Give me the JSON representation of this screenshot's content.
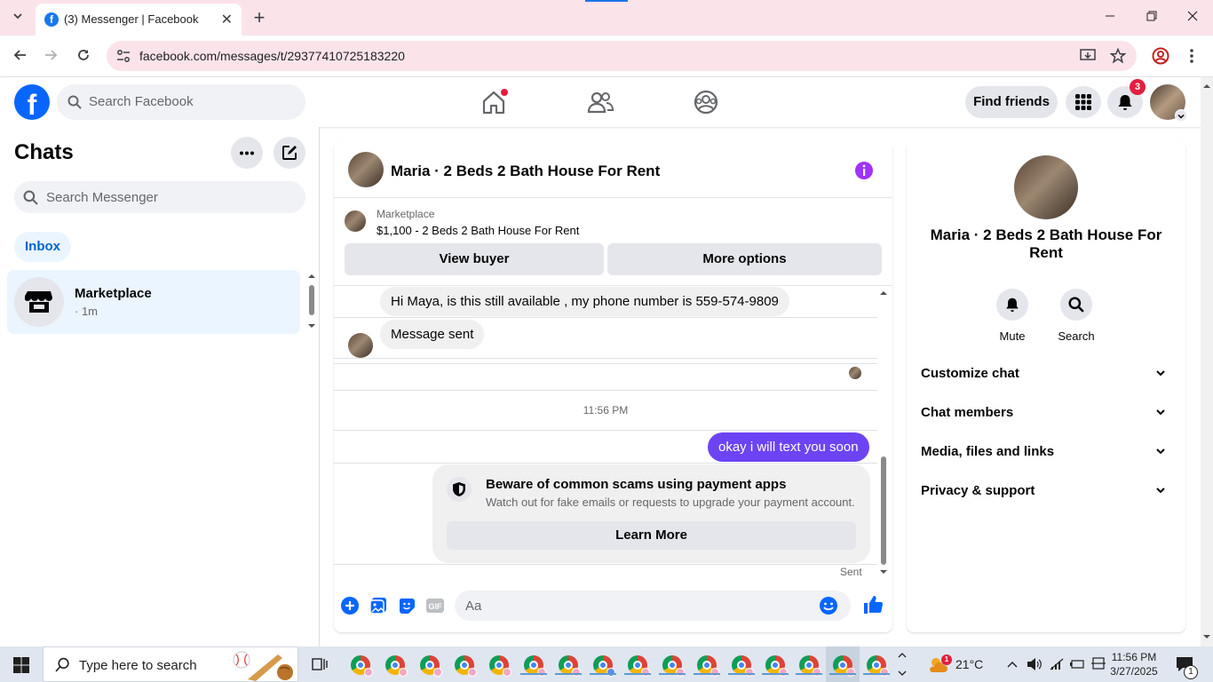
{
  "browser": {
    "tab_title": "(3) Messenger | Facebook",
    "url": "facebook.com/messages/t/29377410725183220"
  },
  "fb": {
    "search_placeholder": "Search Facebook",
    "find_friends": "Find friends",
    "notif_count": "3"
  },
  "chats": {
    "title": "Chats",
    "search_placeholder": "Search Messenger",
    "inbox_label": "Inbox",
    "items": [
      {
        "name": "Marketplace",
        "time": "· 1m"
      }
    ]
  },
  "conversation": {
    "title": "Maria · 2 Beds 2 Bath House For Rent",
    "marketplace_label": "Marketplace",
    "listing": "$1,100 - 2 Beds 2 Bath House For Rent",
    "view_buyer": "View buyer",
    "more_options": "More options",
    "messages": {
      "in1": "Hi Maya, is this still available , my phone number is 559-574-9809",
      "in2": "Message sent",
      "time": "11:56 PM",
      "out1": "okay i will text you soon"
    },
    "scam": {
      "title": "Beware of common scams using payment apps",
      "desc": "Watch out for fake emails or requests to upgrade your payment account.",
      "button": "Learn More"
    },
    "sent_status": "Sent",
    "composer_placeholder": "Aa"
  },
  "info_panel": {
    "name": "Maria · 2 Beds 2 Bath House For Rent",
    "mute": "Mute",
    "search": "Search",
    "sections": [
      "Customize chat",
      "Chat members",
      "Media, files and links",
      "Privacy & support"
    ]
  },
  "taskbar": {
    "search_placeholder": "Type here to search",
    "weather": "21°C",
    "weather_badge": "1",
    "time": "11:56 PM",
    "date": "3/27/2025",
    "notif_count": "1"
  },
  "colors": {
    "fb_blue": "#0866ff",
    "outgoing_bubble": "#6c44f4",
    "badge_red": "#e41e3f",
    "info_purple": "#a033ff"
  }
}
